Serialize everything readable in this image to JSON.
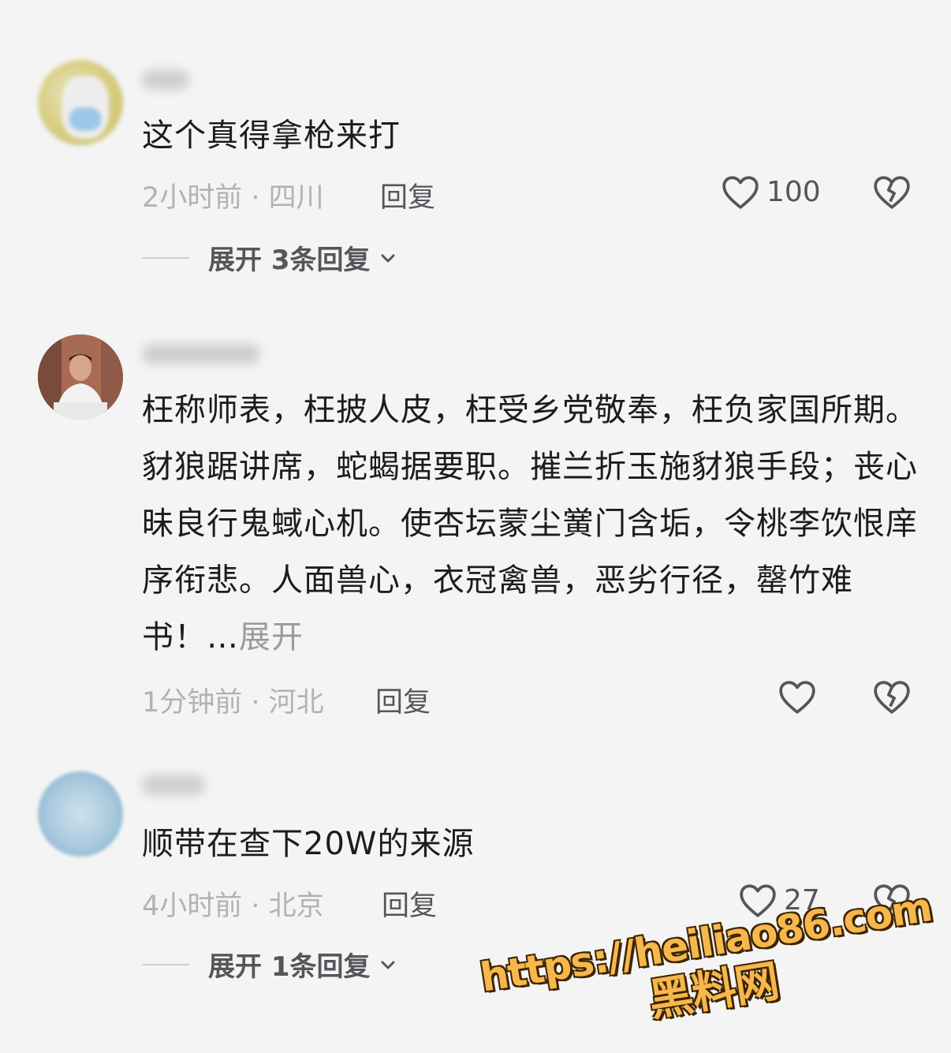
{
  "comments": [
    {
      "text": "这个真得拿枪来打",
      "meta": "2小时前 · 四川",
      "reply_label": "回复",
      "likes": "100",
      "expand_label": "展开 3条回复"
    },
    {
      "text": "枉称师表，枉披人皮，枉受乡党敬奉，枉负家国所期。豺狼踞讲席，蛇蝎据要职。摧兰折玉施豺狼手段；丧心昧良行鬼蜮心机。使杏坛蒙尘黉门含垢，令桃李饮恨庠序衔悲。人面兽心，衣冠禽兽，恶劣行径，罄竹难书！…",
      "inline_expand": "展开",
      "meta": "1分钟前 · 河北",
      "reply_label": "回复",
      "likes": ""
    },
    {
      "text": "顺带在查下20W的来源",
      "meta": "4小时前 · 北京",
      "reply_label": "回复",
      "likes": "27",
      "expand_label": "展开 1条回复"
    }
  ],
  "watermark": {
    "url": "https://heiliao86.com",
    "name": "黑料网"
  }
}
